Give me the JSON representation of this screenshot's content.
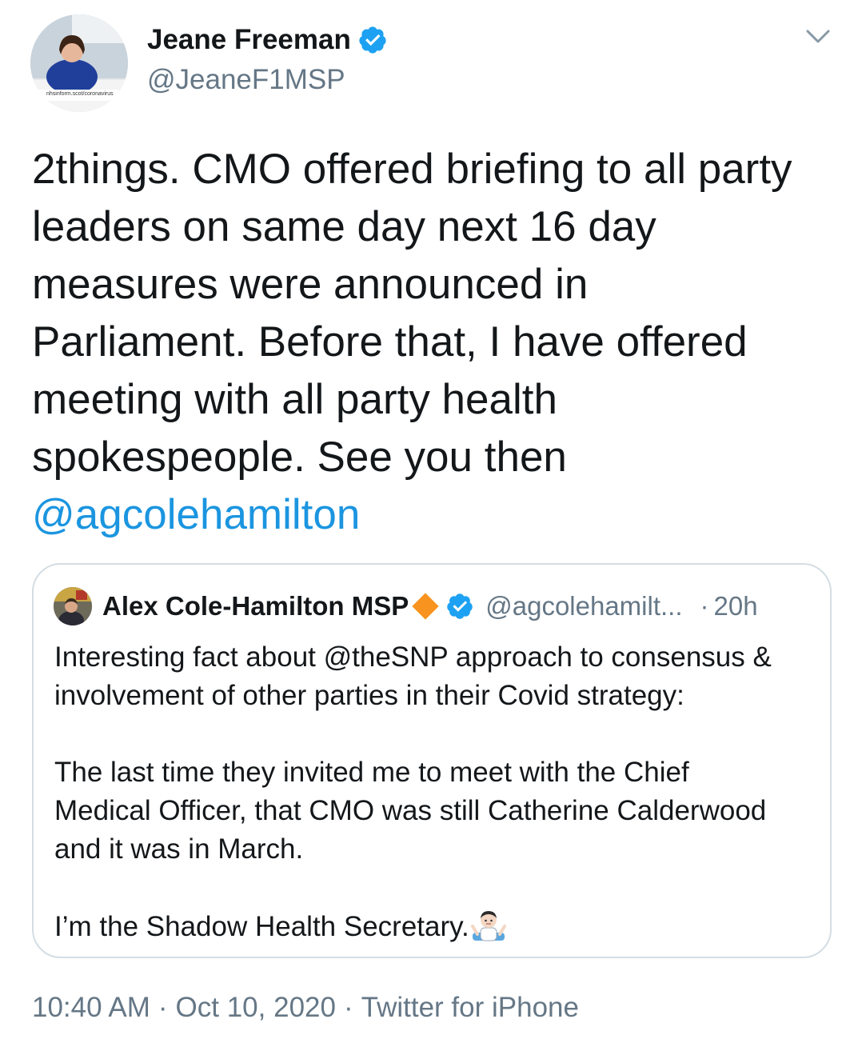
{
  "tweet": {
    "author": {
      "display_name": "Jeane Freeman",
      "handle": "@JeaneF1MSP",
      "verified": true,
      "avatar_caption": "nhsinform.scot/coronavirus"
    },
    "text_lines": [
      "2things. CMO offered briefing to all party",
      "leaders on same day next 16 day",
      "measures were announced in",
      "Parliament. Before that, I have offered",
      "meeting with all party health",
      "spokespeople. See you then"
    ],
    "mention": "@agcolehamilton",
    "menu_icon": "chevron-down-icon",
    "timestamp_time": "10:40 AM",
    "timestamp_date": "Oct 10, 2020",
    "source": "Twitter for iPhone",
    "separator": "·"
  },
  "quoted_tweet": {
    "author": {
      "display_name": "Alex Cole-Hamilton MSP",
      "handle": "@agcolehamilt...",
      "verified": true
    },
    "separator": "·",
    "time": "20h",
    "paragraph1_lines": [
      "Interesting fact about @theSNP approach to consensus &",
      "involvement of other parties in their Covid strategy:"
    ],
    "paragraph2_lines": [
      "The last time they invited me to meet with the Chief",
      "Medical Officer, that CMO was still Catherine Calderwood",
      "and it was in March."
    ],
    "paragraph3": "I’m the Shadow Health Secretary.",
    "emoji": "person-shrugging-emoji"
  },
  "colors": {
    "text": "#14171a",
    "muted": "#657786",
    "link": "#1b95e0",
    "verified": "#1da1f2",
    "border": "#d4dde3",
    "diamond": "#f7931e"
  }
}
